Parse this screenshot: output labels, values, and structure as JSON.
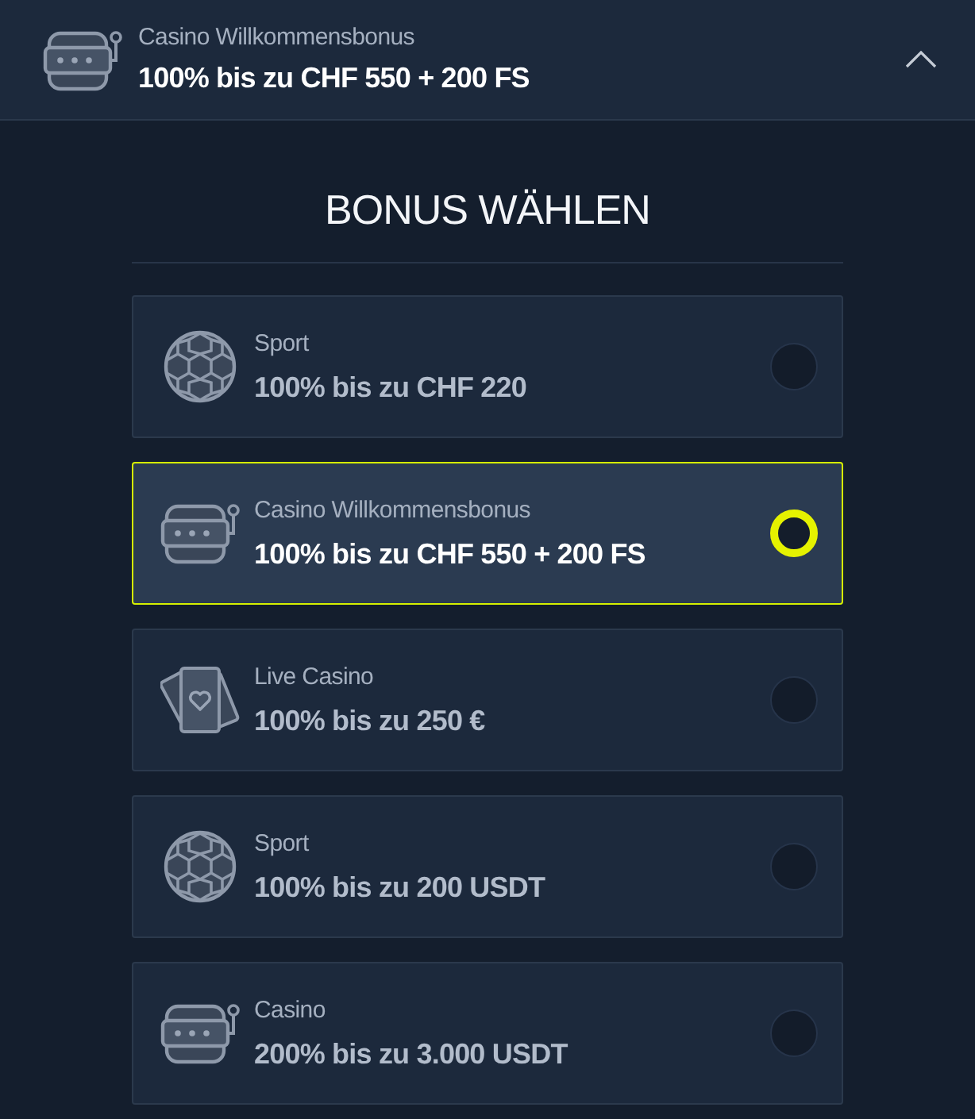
{
  "header": {
    "kind": "slot",
    "label": "Casino Willkommensbonus",
    "value": "100% bis zu CHF 550 + 200 FS",
    "expanded": true
  },
  "title": "BONUS WÄHLEN",
  "bonuses": [
    {
      "kind": "sport",
      "label": "Sport",
      "value": "100% bis zu CHF 220",
      "selected": false
    },
    {
      "kind": "slot",
      "label": "Casino Willkommensbonus",
      "value": "100% bis zu CHF 550 + 200 FS",
      "selected": true
    },
    {
      "kind": "cards",
      "label": "Live Casino",
      "value": "100% bis zu 250 €",
      "selected": false
    },
    {
      "kind": "sport",
      "label": "Sport",
      "value": "100% bis zu 200 USDT",
      "selected": false
    },
    {
      "kind": "slot",
      "label": "Casino",
      "value": "200% bis zu 3.000 USDT",
      "selected": false
    }
  ]
}
